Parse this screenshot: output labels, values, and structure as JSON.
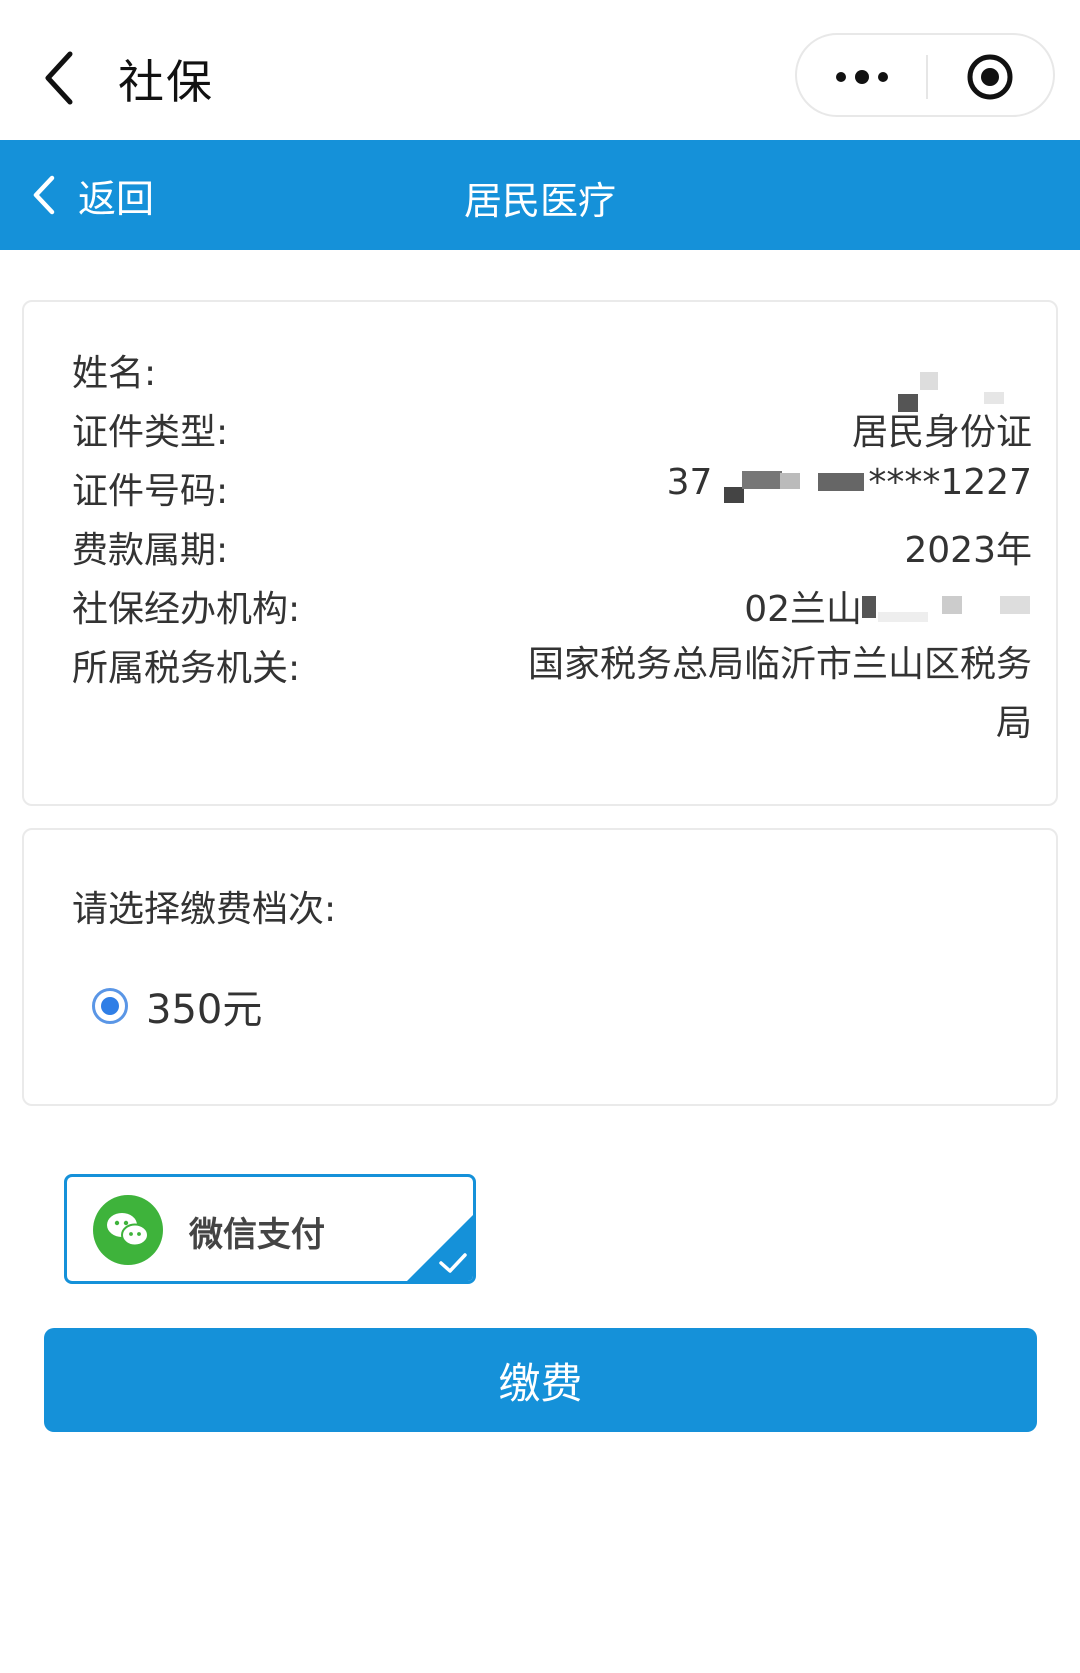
{
  "titlebar": {
    "title": "社保"
  },
  "header": {
    "back_label": "返回",
    "title": "居民医疗"
  },
  "info": {
    "name": {
      "label": "姓名:",
      "value": ""
    },
    "id_type": {
      "label": "证件类型:",
      "value": "居民身份证"
    },
    "id_number": {
      "label": "证件号码:",
      "value_prefix": "37",
      "value_suffix": "****1227"
    },
    "period": {
      "label": "费款属期:",
      "value": "2023年"
    },
    "agency": {
      "label": "社保经办机构:",
      "value": "02兰山"
    },
    "tax_office": {
      "label": "所属税务机关:",
      "value": "国家税务总局临沂市兰山区税务局"
    }
  },
  "fee_level": {
    "label": "请选择缴费档次:",
    "options": [
      {
        "label": "350元",
        "selected": true
      }
    ]
  },
  "payment": {
    "method_label": "微信支付",
    "selected": true
  },
  "submit": {
    "label": "缴费"
  },
  "colors": {
    "primary": "#1591d9",
    "radio": "#2f7ee6",
    "wechat_green": "#3eb33b"
  }
}
